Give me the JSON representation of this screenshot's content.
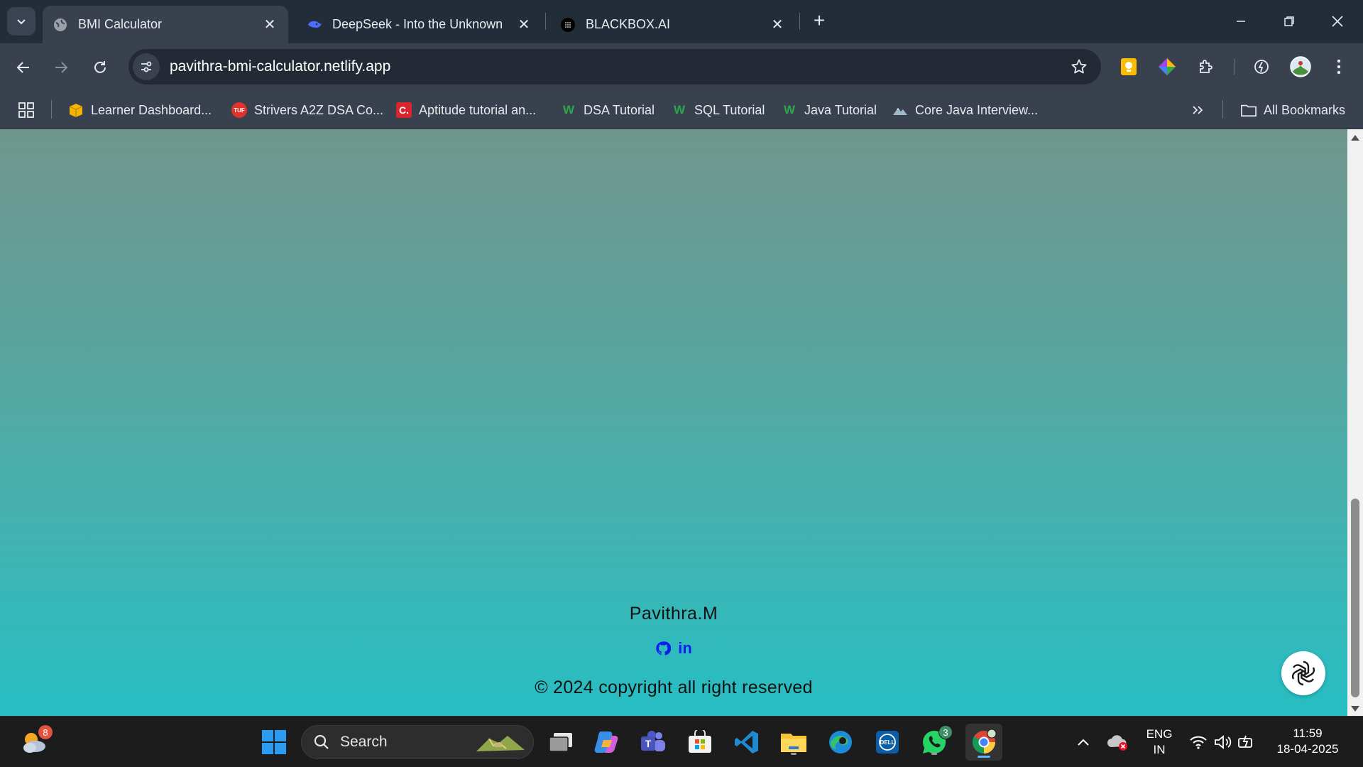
{
  "browser": {
    "tabs": [
      {
        "title": "BMI Calculator",
        "active": true
      },
      {
        "title": "DeepSeek - Into the Unknown",
        "active": false
      },
      {
        "title": "BLACKBOX.AI",
        "active": false
      }
    ],
    "url": "pavithra-bmi-calculator.netlify.app",
    "bookmarks": [
      {
        "label": "Learner Dashboard..."
      },
      {
        "label": "Strivers A2Z DSA Co...",
        "icon_text": "TUF"
      },
      {
        "label": "Aptitude tutorial an...",
        "icon_text": "C."
      },
      {
        "label": "DSA Tutorial",
        "icon_text": "W"
      },
      {
        "label": "SQL Tutorial",
        "icon_text": "W"
      },
      {
        "label": "Java Tutorial",
        "icon_text": "W"
      },
      {
        "label": "Core Java Interview..."
      }
    ],
    "all_bookmarks_label": "All Bookmarks"
  },
  "page": {
    "author": "Pavithra.M",
    "linkedin_label": "in",
    "copyright": "© 2024 copyright all right reserved",
    "colors": {
      "gradient_top": "#6f968c",
      "gradient_bottom": "#26bec3",
      "social_link": "#0b1ff0"
    }
  },
  "taskbar": {
    "weather_badge": "8",
    "search_label": "Search",
    "whatsapp_badge": "3",
    "language": {
      "line1": "ENG",
      "line2": "IN"
    },
    "time": "11:59",
    "date": "18-04-2025"
  }
}
